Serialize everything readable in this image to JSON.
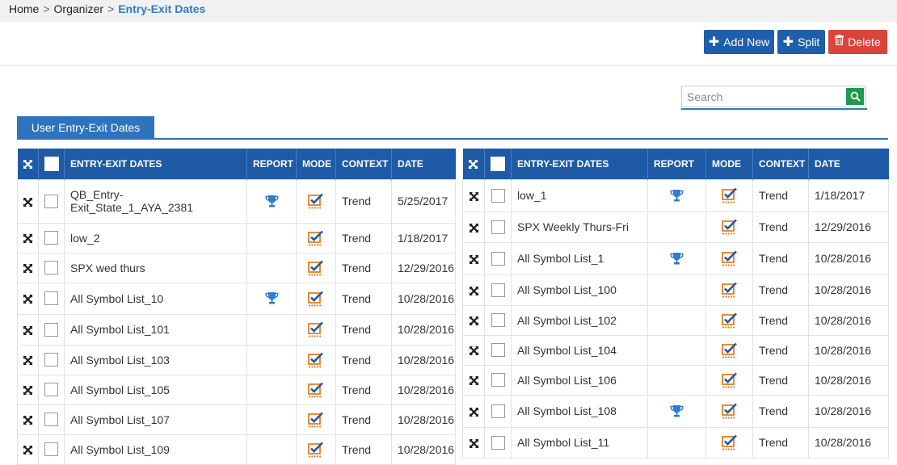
{
  "breadcrumb": {
    "items": [
      "Home",
      "Organizer"
    ],
    "current": "Entry-Exit Dates",
    "separator": ">"
  },
  "toolbar": {
    "add_label": "Add New",
    "split_label": "Split",
    "delete_label": "Delete"
  },
  "search": {
    "placeholder": "Search",
    "value": ""
  },
  "tabs": [
    {
      "label": "User Entry-Exit Dates",
      "active": true
    }
  ],
  "columns": [
    "ENTRY-EXIT DATES",
    "REPORT",
    "MODE",
    "CONTEXT",
    "DATE"
  ],
  "colors": {
    "primary": "#1f5aa6",
    "danger": "#d9453b",
    "search_green": "#1e9a4c",
    "trophy": "#2d7dd2",
    "mode_orange": "#e67e22"
  },
  "left_rows": [
    {
      "name": "QB_Entry-Exit_State_1_AYA_2381",
      "report": true,
      "context": "Trend",
      "date": "5/25/2017"
    },
    {
      "name": "low_2",
      "report": false,
      "context": "Trend",
      "date": "1/18/2017"
    },
    {
      "name": "SPX wed thurs",
      "report": false,
      "context": "Trend",
      "date": "12/29/2016"
    },
    {
      "name": "All Symbol List_10",
      "report": true,
      "context": "Trend",
      "date": "10/28/2016"
    },
    {
      "name": "All Symbol List_101",
      "report": false,
      "context": "Trend",
      "date": "10/28/2016"
    },
    {
      "name": "All Symbol List_103",
      "report": false,
      "context": "Trend",
      "date": "10/28/2016"
    },
    {
      "name": "All Symbol List_105",
      "report": false,
      "context": "Trend",
      "date": "10/28/2016"
    },
    {
      "name": "All Symbol List_107",
      "report": false,
      "context": "Trend",
      "date": "10/28/2016"
    },
    {
      "name": "All Symbol List_109",
      "report": false,
      "context": "Trend",
      "date": "10/28/2016"
    }
  ],
  "right_rows": [
    {
      "name": "low_1",
      "report": true,
      "context": "Trend",
      "date": "1/18/2017"
    },
    {
      "name": "SPX Weekly Thurs-Fri",
      "report": false,
      "context": "Trend",
      "date": "12/29/2016"
    },
    {
      "name": "All Symbol List_1",
      "report": true,
      "context": "Trend",
      "date": "10/28/2016"
    },
    {
      "name": "All Symbol List_100",
      "report": false,
      "context": "Trend",
      "date": "10/28/2016"
    },
    {
      "name": "All Symbol List_102",
      "report": false,
      "context": "Trend",
      "date": "10/28/2016"
    },
    {
      "name": "All Symbol List_104",
      "report": false,
      "context": "Trend",
      "date": "10/28/2016"
    },
    {
      "name": "All Symbol List_106",
      "report": false,
      "context": "Trend",
      "date": "10/28/2016"
    },
    {
      "name": "All Symbol List_108",
      "report": true,
      "context": "Trend",
      "date": "10/28/2016"
    },
    {
      "name": "All Symbol List_11",
      "report": false,
      "context": "Trend",
      "date": "10/28/2016"
    }
  ]
}
